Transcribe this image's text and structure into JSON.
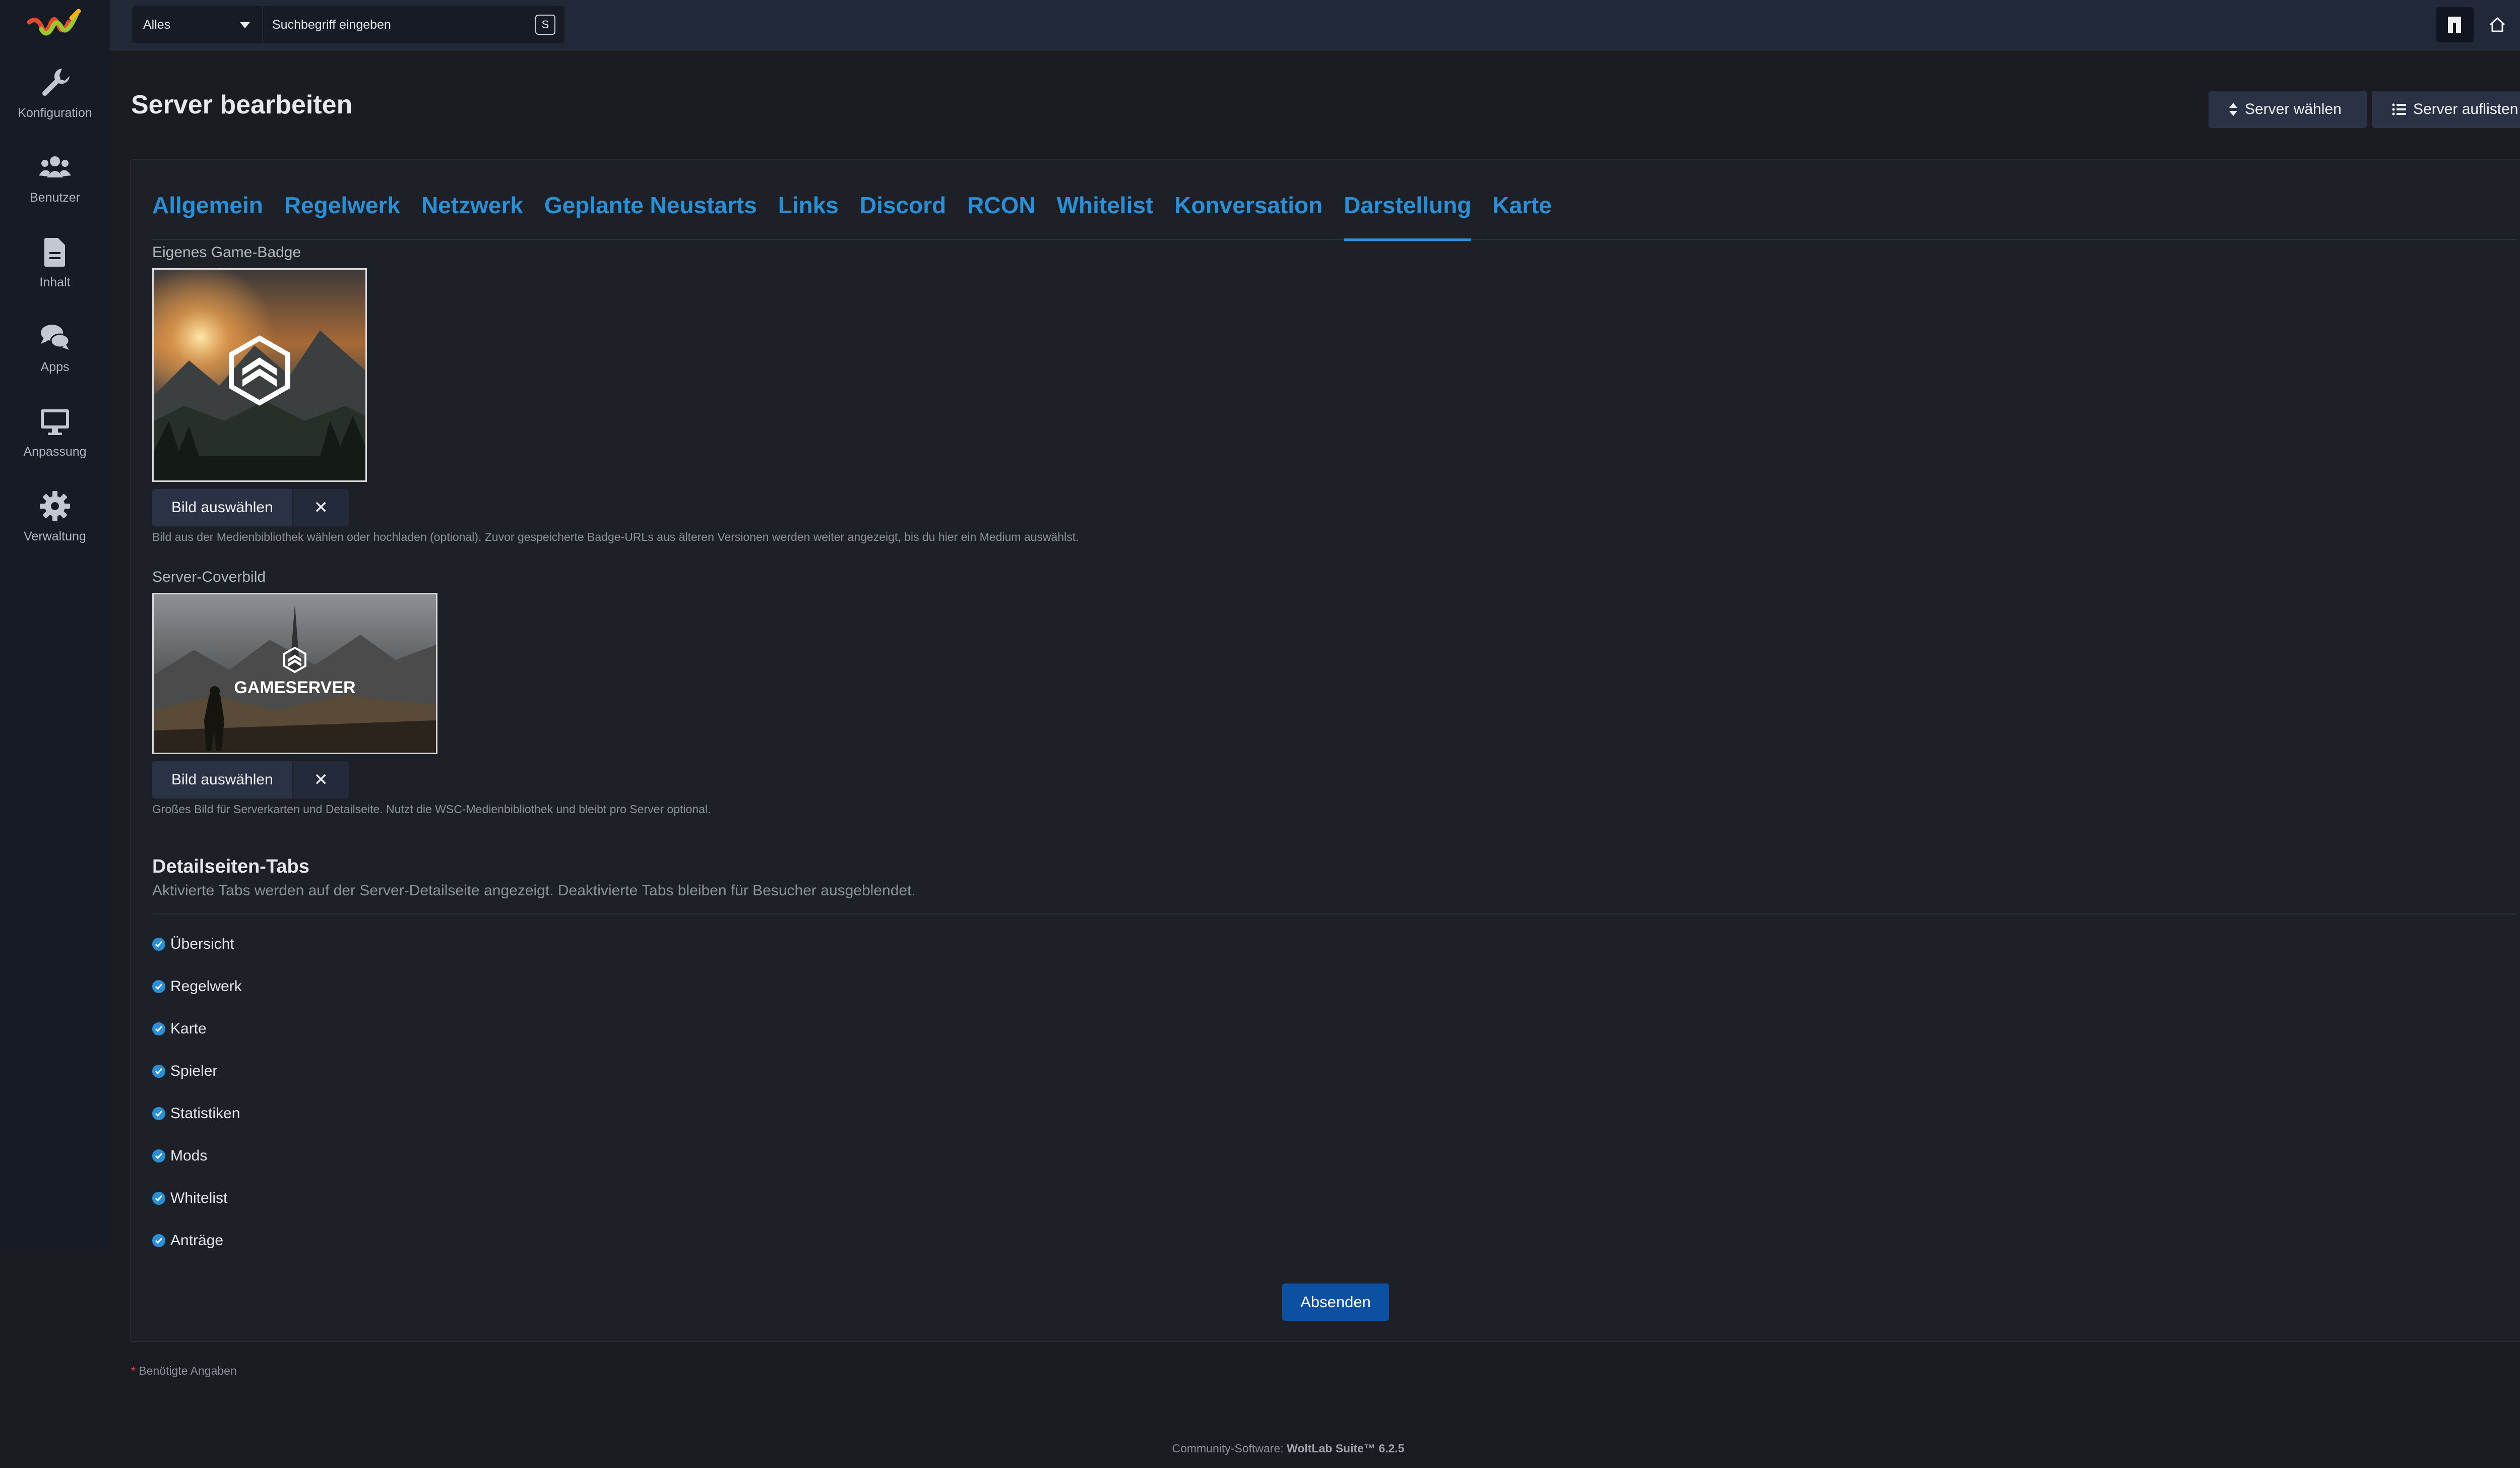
{
  "sidebar": {
    "items": [
      {
        "label": "Konfiguration",
        "icon": "wrench-icon"
      },
      {
        "label": "Benutzer",
        "icon": "users-icon"
      },
      {
        "label": "Inhalt",
        "icon": "file-icon"
      },
      {
        "label": "Apps",
        "icon": "comments-icon"
      },
      {
        "label": "Anpassung",
        "icon": "monitor-icon"
      },
      {
        "label": "Verwaltung",
        "icon": "gear-icon"
      }
    ]
  },
  "topbar": {
    "search_scope": "Alles",
    "search_placeholder": "Suchbegriff eingeben",
    "search_shortcut": "S"
  },
  "header": {
    "title": "Server bearbeiten",
    "choose_server": "Server wählen",
    "list_servers": "Server auflisten"
  },
  "tabs": [
    {
      "label": "Allgemein"
    },
    {
      "label": "Regelwerk"
    },
    {
      "label": "Netzwerk"
    },
    {
      "label": "Geplante Neustarts"
    },
    {
      "label": "Links"
    },
    {
      "label": "Discord"
    },
    {
      "label": "RCON"
    },
    {
      "label": "Whitelist"
    },
    {
      "label": "Konversation"
    },
    {
      "label": "Darstellung"
    },
    {
      "label": "Karte"
    }
  ],
  "badge": {
    "label": "Eigenes Game-Badge",
    "pick_label": "Bild auswählen",
    "clear_symbol": "✕",
    "help": "Bild aus der Medienbibliothek wählen oder hochladen (optional). Zuvor gespeicherte Badge-URLs aus älteren Versionen werden weiter angezeigt, bis du hier ein Medium auswählst."
  },
  "cover": {
    "label": "Server-Coverbild",
    "pick_label": "Bild auswählen",
    "clear_symbol": "✕",
    "image_text": "GAMESERVER",
    "help": "Großes Bild für Serverkarten und Detailseite. Nutzt die WSC-Medienbibliothek und bleibt pro Server optional."
  },
  "detail_tabs": {
    "title": "Detailseiten-Tabs",
    "description": "Aktivierte Tabs werden auf der Server-Detailseite angezeigt. Deaktivierte Tabs bleiben für Besucher ausgeblendet.",
    "items": [
      {
        "label": "Übersicht",
        "checked": true
      },
      {
        "label": "Regelwerk",
        "checked": true
      },
      {
        "label": "Karte",
        "checked": true
      },
      {
        "label": "Spieler",
        "checked": true
      },
      {
        "label": "Statistiken",
        "checked": true
      },
      {
        "label": "Mods",
        "checked": true
      },
      {
        "label": "Whitelist",
        "checked": true
      },
      {
        "label": "Anträge",
        "checked": true
      }
    ]
  },
  "form": {
    "submit_label": "Absenden",
    "required_star": "*",
    "required_note": "Benötigte Angaben"
  },
  "footer": {
    "prefix": "Community-Software:",
    "product": "WoltLab Suite™ 6.2.5"
  },
  "colors": {
    "accent": "#2b8fd6",
    "submit": "#0d4fa0",
    "sidebar_bg": "#161b25",
    "topbar_bg": "#212837"
  }
}
